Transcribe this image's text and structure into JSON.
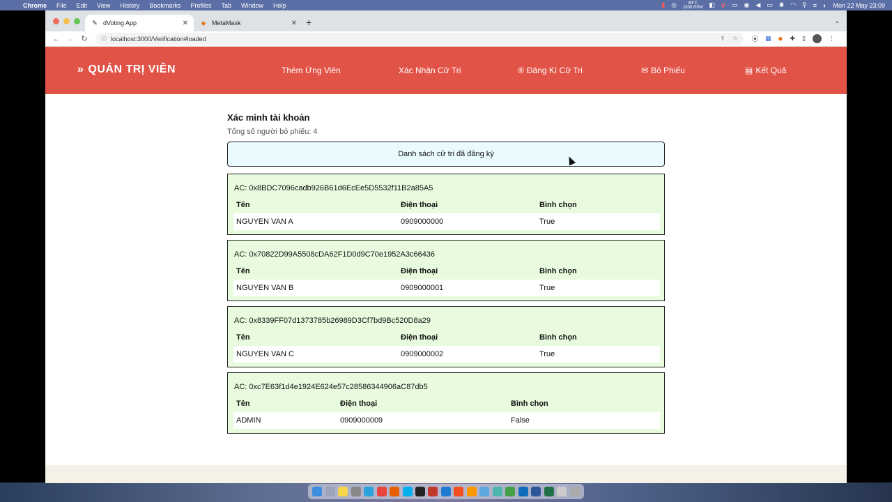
{
  "menubar": {
    "app": "Chrome",
    "items": [
      "File",
      "Edit",
      "View",
      "History",
      "Bookmarks",
      "Profiles",
      "Tab",
      "Window",
      "Help"
    ],
    "temp": "89°C",
    "rpm": "2830 RPM",
    "datetime": "Mon 22 May  23:09"
  },
  "browser": {
    "tabs": [
      {
        "title": "dVoting App",
        "active": true
      },
      {
        "title": "MetaMask",
        "active": false
      }
    ],
    "url": "localhost:3000/Verification#loaded"
  },
  "app": {
    "brand": "QUẢN TRỊ VIÊN",
    "nav": [
      {
        "label": "Thêm Ứng Viên",
        "icon": ""
      },
      {
        "label": "Xác Nhận Cử Tri",
        "icon": ""
      },
      {
        "label": "Đăng Kí Cử Tri",
        "icon": "®"
      },
      {
        "label": "Bỏ Phiếu",
        "icon": "ballot-icon"
      },
      {
        "label": "Kết Quả",
        "icon": "results-icon"
      }
    ]
  },
  "main": {
    "title": "Xác minh tài khoản",
    "total_label": "Tổng số người bỏ phiếu: 4",
    "list_header": "Danh sách cử tri đã đăng ký",
    "col_headers": {
      "name": "Tên",
      "phone": "Điện thoại",
      "voted": "Bình chọn"
    },
    "voters": [
      {
        "ac": "AC: 0x8BDC7096cadb926B61d6EcEe5D5532f11B2a85A5",
        "name": "NGUYEN VAN A",
        "phone": "0909000000",
        "voted": "True"
      },
      {
        "ac": "AC: 0x70822D99A5508cDA62F1D0d9C70e1952A3c66436",
        "name": "NGUYEN VAN B",
        "phone": "0909000001",
        "voted": "True"
      },
      {
        "ac": "AC: 0x8339FF07d1373785b26989D3Cf7bd9Bc520D8a29",
        "name": "NGUYEN VAN C",
        "phone": "0909000002",
        "voted": "True"
      },
      {
        "ac": "AC: 0xc7E63f1d4e1924E624e57c28586344906aC87db5",
        "name": "ADMIN",
        "phone": "0909000009",
        "voted": "False"
      }
    ]
  }
}
